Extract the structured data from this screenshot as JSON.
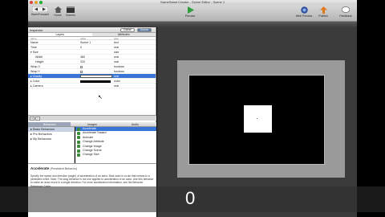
{
  "window": {
    "title": "GameSalad Creator - Scene Editor - Scene 1"
  },
  "toolbar": {
    "back_forward": "Back/Forward",
    "home": "Home",
    "scenes": "Scenes",
    "preview": "Preview",
    "web_preview": "Web Preview",
    "publish": "Publish",
    "feedback": "Feedback"
  },
  "inspector": {
    "title": "Inspector",
    "game_button": "Game",
    "scene_button": "Scene",
    "tabs": [
      "Layers",
      "Attributes"
    ],
    "columns": [
      "name",
      "value",
      "type"
    ],
    "rows": [
      {
        "name": "Name",
        "value": "Scene 1",
        "type": "text"
      },
      {
        "name": "Time",
        "value": "0",
        "type": "real"
      },
      {
        "name": "▾ Size",
        "value": "",
        "type": "size"
      },
      {
        "name": "Width",
        "value": "480",
        "type": "real"
      },
      {
        "name": "Height",
        "value": "320",
        "type": "real"
      },
      {
        "name": "Wrap X",
        "value": "",
        "type": "boolean"
      },
      {
        "name": "Wrap Y",
        "value": "",
        "type": "boolean"
      },
      {
        "name": "▸ Gravity",
        "value": "0",
        "type": "real"
      },
      {
        "name": "▸ Color",
        "value": "",
        "type": "color"
      },
      {
        "name": "▸ Camera",
        "value": "",
        "type": "real"
      }
    ]
  },
  "library": {
    "tabs": [
      "Behaviors",
      "Images",
      "Audio"
    ],
    "categories": [
      "Basic Behaviors",
      "Pro Behaviors",
      "My Behaviors"
    ],
    "behaviors": [
      "Accelerate",
      "Accelerate Toward",
      "Animate",
      "Change Attribute",
      "Change Image",
      "Change Scene",
      "Change Size"
    ]
  },
  "description": {
    "title": "Accelerate",
    "subtitle": "(Persistent Behavior)",
    "text": "Specify the speed and direction (angle) of acceleration of an actor. Best used in a rule that means to a persistent event. Note: The drag behavior is not one applied to acceleration of an actor. Use this behavior to make an actor move in a single direction. For more acceleration information, see the Behavior Reference Guide."
  },
  "scene": {
    "counter": "0"
  },
  "colors": {
    "selection": "#3875d7",
    "scene_bg": "#3b3b3b"
  }
}
